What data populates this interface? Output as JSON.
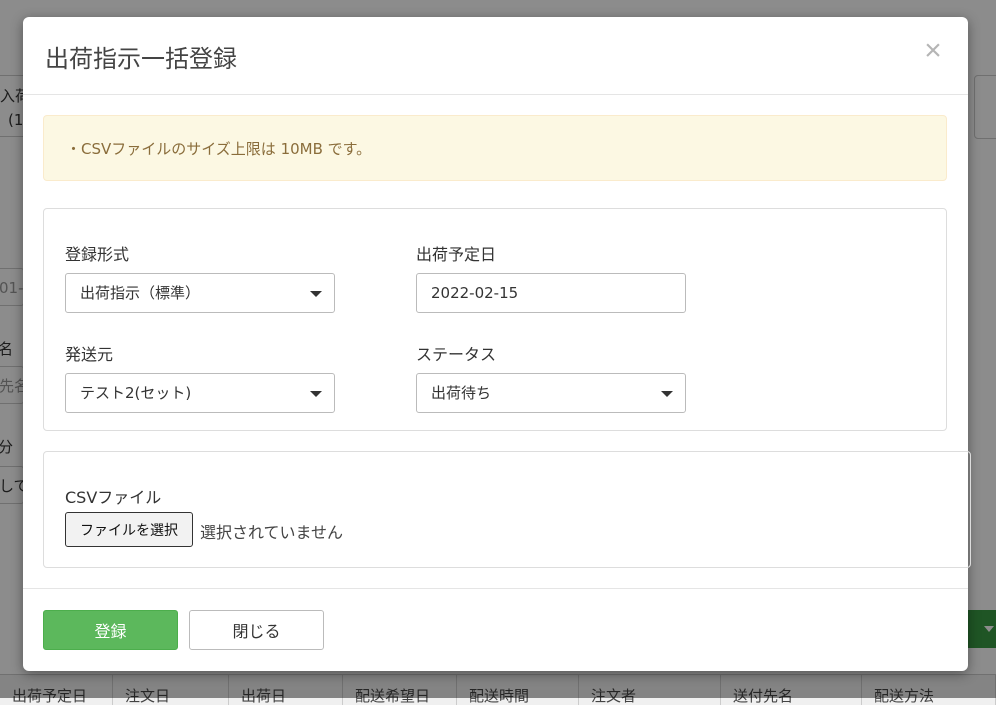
{
  "background": {
    "card_left_lines": [
      "入荷",
      "(1"
    ],
    "date_fragment": "01-",
    "label_fragment_1": "名",
    "placeholder_fragment": "先名",
    "label_fragment_2": "分",
    "value_fragment": "して",
    "table_headers": [
      "出荷予定日",
      "注文日",
      "出荷日",
      "配送希望日",
      "配送時間",
      "注文者",
      "送付先名",
      "配送方法"
    ]
  },
  "modal": {
    "title": "出荷指示一括登録",
    "close_glyph": "×",
    "notice": "・CSVファイルのサイズ上限は 10MB です。",
    "form": {
      "register_format": {
        "label": "登録形式",
        "value": "出荷指示（標準）"
      },
      "ship_date": {
        "label": "出荷予定日",
        "value": "2022-02-15"
      },
      "sender": {
        "label": "発送元",
        "value": "テスト2(セット)"
      },
      "status": {
        "label": "ステータス",
        "value": "出荷待ち"
      }
    },
    "file": {
      "label": "CSVファイル",
      "button": "ファイルを選択",
      "status": "選択されていません"
    },
    "footer": {
      "submit": "登録",
      "close": "閉じる"
    }
  }
}
